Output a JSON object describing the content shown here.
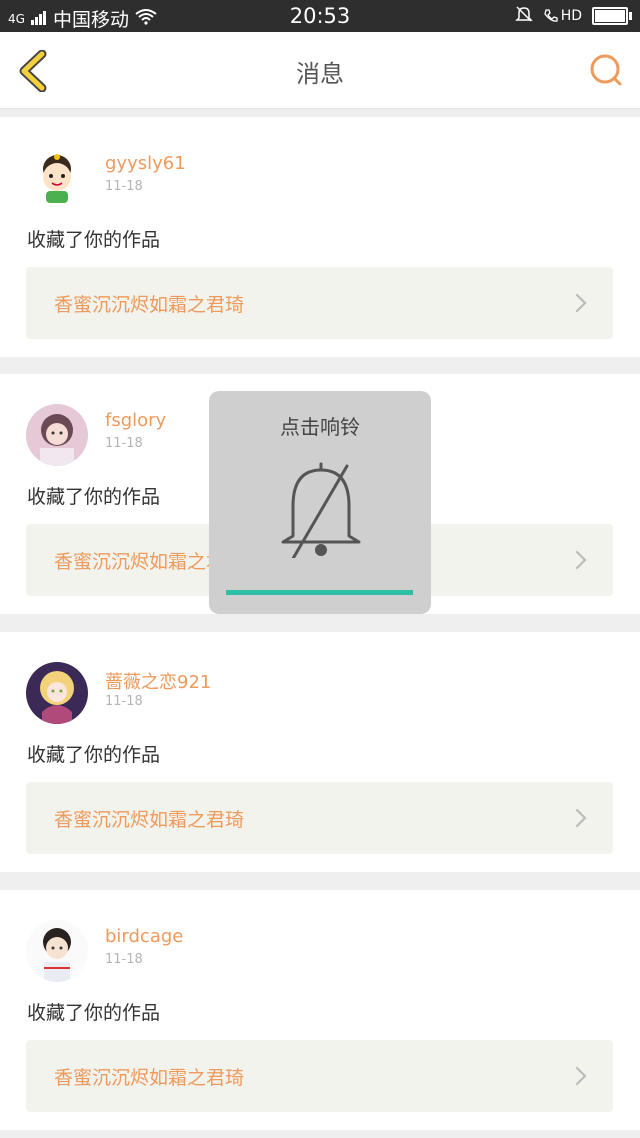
{
  "status_bar": {
    "network": "4G",
    "carrier": "中国移动",
    "time": "20:53",
    "hd": "HD",
    "battery_level": 0.95
  },
  "header": {
    "title": "消息",
    "back_icon": "back-chevron-icon",
    "search_icon": "search-icon"
  },
  "messages": [
    {
      "username": "gyysly61",
      "date": "11-18",
      "action": "收藏了你的作品",
      "work_title": "香蜜沉沉烬如霜之君琦"
    },
    {
      "username": "fsglory",
      "date": "11-18",
      "action": "收藏了你的作品",
      "work_title": "香蜜沉沉烬如霜之君琦"
    },
    {
      "username": "蔷薇之恋921",
      "date": "11-18",
      "action": "收藏了你的作品",
      "work_title": "香蜜沉沉烬如霜之君琦"
    },
    {
      "username": "birdcage",
      "date": "11-18",
      "action": "收藏了你的作品",
      "work_title": "香蜜沉沉烬如霜之君琦"
    }
  ],
  "toast": {
    "text": "点击响铃",
    "icon": "bell-off-icon",
    "progress": 1.0
  },
  "colors": {
    "accent": "#ee9a5c",
    "teal": "#2fbfa4",
    "back_yellow": "#f4d13c"
  }
}
